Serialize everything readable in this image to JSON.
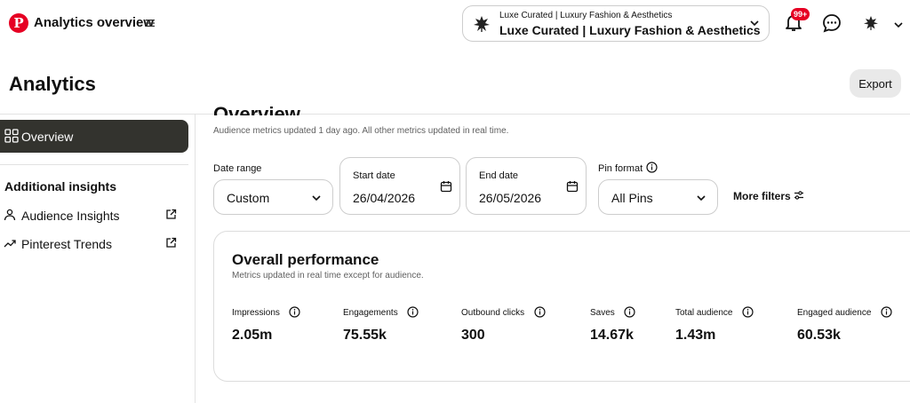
{
  "topbar": {
    "app_title": "Analytics overview",
    "account_small": "Luxe Curated | Luxury Fashion & Aesthetics",
    "account_big": "Luxe Curated | Luxury Fashion & Aesthetics",
    "notification_badge": "99+"
  },
  "header": {
    "title": "Analytics",
    "export_label": "Export"
  },
  "sidebar": {
    "overview_label": "Overview",
    "section_heading": "Additional insights",
    "links": [
      {
        "label": "Audience Insights"
      },
      {
        "label": "Pinterest Trends"
      }
    ]
  },
  "main": {
    "section_heading": "Overview",
    "updated_note": "Audience metrics updated 1 day ago. All other metrics updated in real time.",
    "filters": {
      "date_range_label": "Date range",
      "date_range_value": "Custom",
      "start_date_label": "Start date",
      "start_date_value": "26/04/2026",
      "end_date_label": "End date",
      "end_date_value": "26/05/2026",
      "pin_format_label": "Pin format",
      "pin_format_value": "All Pins",
      "more_filters_label": "More filters"
    },
    "performance": {
      "title": "Overall performance",
      "subtitle": "Metrics updated in real time except for audience.",
      "metrics": [
        {
          "label": "Impressions",
          "value": "2.05m"
        },
        {
          "label": "Engagements",
          "value": "75.55k"
        },
        {
          "label": "Outbound clicks",
          "value": "300"
        },
        {
          "label": "Saves",
          "value": "14.67k"
        },
        {
          "label": "Total audience",
          "value": "1.43m"
        },
        {
          "label": "Engaged audience",
          "value": "60.53k"
        }
      ]
    }
  },
  "colors": {
    "brand": "#e60023",
    "nav_active_bg": "#33332e",
    "border": "#cdcdcd"
  }
}
